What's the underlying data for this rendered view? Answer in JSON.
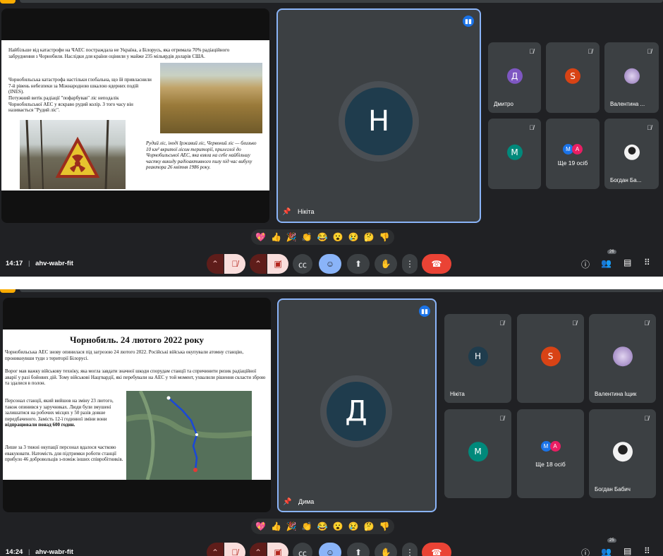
{
  "call": {
    "code": "ahv-wabr-fit"
  },
  "frame1": {
    "time": "14:17",
    "participant_count": "26",
    "main_speaker": {
      "initial": "Н",
      "name": "Нікіта"
    },
    "tiles": [
      {
        "initial": "Д",
        "name": "Дмитро",
        "color": "#7e57c2"
      },
      {
        "initial": "S",
        "name": "",
        "color": "#d84315"
      },
      {
        "initial": "",
        "name": "Валентина ...",
        "color": "#b39ddb"
      },
      {
        "initial": "M",
        "name": "",
        "color": "#00897b"
      },
      {
        "initial": "",
        "name": "Ще 19 осіб",
        "color": ""
      },
      {
        "initial": "",
        "name": "Богдан Ба...",
        "color": "#e0e0e0"
      }
    ],
    "more_avatars": [
      "M",
      "A"
    ],
    "slide": {
      "p1": "Найбільше від катастрофи на ЧАЕС постраждала не Україна, а Білорусь, яка отримала 70% радіаційного забруднення з Чорнобиля. Наслідки для країни оцінили у майже 235 мільярдів доларів США.",
      "p2": "Чорнобильська катастрофа настільки глобальна, що їй привласнили 7-й рівень небезпеки за Міжнародною шкалою ядерних подій (INES).",
      "p3": "Потужний витік радіації \"пофарбував\" ліс неподалік Чорнобильської АЕС у яскраво рудий колір. З того часу він називається \"Рудий ліс\".",
      "caption": "Рудий ліс, іноді Іржавий ліс, Червоний ліс — близько 10 км² вкритої лісом території, прилеглої до Чорнобильської АЕС, яка взяла на себе найбільшу частку викиду радіоактивного пилу під час вибуху реактора 26 квітня 1986 року."
    }
  },
  "frame2": {
    "time": "14:24",
    "participant_count": "25",
    "main_speaker": {
      "initial": "Д",
      "name": "Дима"
    },
    "tiles": [
      {
        "initial": "Н",
        "name": "Нікіта",
        "color": "#1f3c4d"
      },
      {
        "initial": "S",
        "name": "",
        "color": "#d84315"
      },
      {
        "initial": "",
        "name": "Валентина Іщик",
        "color": "#b39ddb"
      },
      {
        "initial": "M",
        "name": "",
        "color": "#00897b"
      },
      {
        "initial": "",
        "name": "Ще 18 осіб",
        "color": ""
      },
      {
        "initial": "",
        "name": "Богдан Бабич",
        "color": "#e0e0e0"
      }
    ],
    "more_avatars": [
      "M",
      "A"
    ],
    "slide": {
      "title": "Чорнобиль. 24 лютого 2022 року",
      "p1": "Чорнобильська АЕС знову опинилася під загрозою 24 лютого 2022. Російські війська окупували атомну станцію, проникнувши туди з території Білорусі.",
      "p2": "Ворог мав важку військову техніку, яка могла завдати значної шкоди спорудам станції та спричинити ризик радіаційної аварії у разі бойових дій. Тому військові Нацгвардії, які перебували на АЕС у той момент, ухвалили рішення скласти зброю та здалися в полон.",
      "p3a": "Персонал станції, який вийшов на зміну 23 лютого, також опинився у заручниках. Люди були змушені залишатися на робочих місцях у 50 разів довше передбаченого. Замість 12-ї годинної зміни вони ",
      "p3b": "відпрацювали понад 600 годин.",
      "p4": "Лише за 3 тижні окупації персонал вдалося частково евакуювати. Натомість для підтримки роботи станції прибуло 46 добровольців з-поміж інших співробітників."
    }
  },
  "reactions": [
    "💖",
    "👍",
    "🎉",
    "👏",
    "😂",
    "😮",
    "😢",
    "🤔",
    "👎"
  ],
  "colors": {
    "accent": "#8ab4f8",
    "hangup": "#ea4335",
    "background": "#202124",
    "tile": "#3c4043"
  }
}
